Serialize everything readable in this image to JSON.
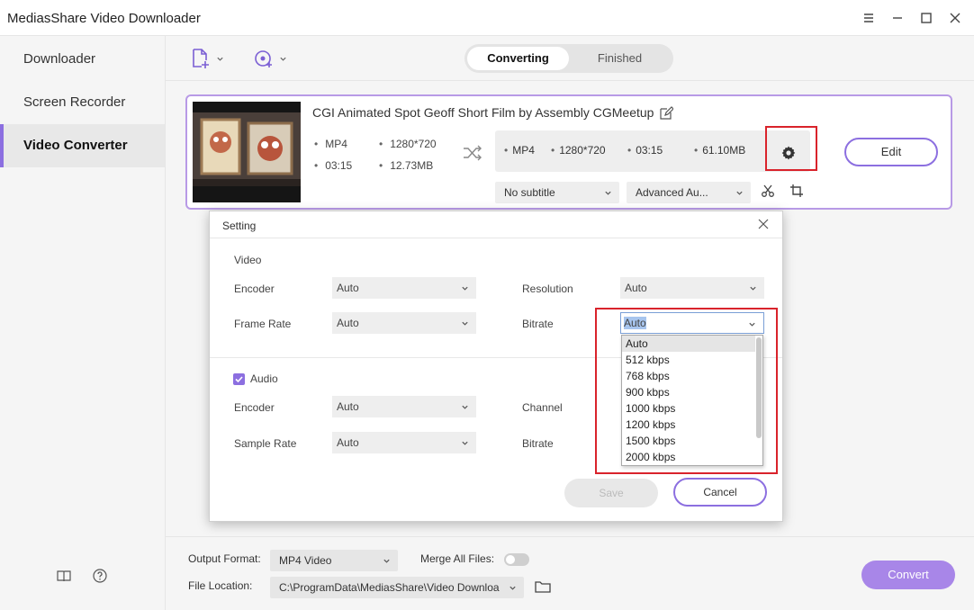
{
  "app": {
    "title": "MediasShare Video Downloader"
  },
  "sidebar": {
    "items": [
      {
        "label": "Downloader"
      },
      {
        "label": "Screen Recorder"
      },
      {
        "label": "Video Converter",
        "active": true
      }
    ]
  },
  "toolbar": {
    "tabs": [
      {
        "label": "Converting",
        "active": true
      },
      {
        "label": "Finished"
      }
    ]
  },
  "video": {
    "title": "CGI Animated Spot Geoff Short Film by Assembly  CGMeetup",
    "source": {
      "format": "MP4",
      "resolution": "1280*720",
      "duration": "03:15",
      "size": "12.73MB"
    },
    "target": {
      "format": "MP4",
      "resolution": "1280*720",
      "duration": "03:15",
      "size": "61.10MB"
    },
    "subtitle": "No subtitle",
    "audio_track": "Advanced Au...",
    "edit_label": "Edit"
  },
  "bottom": {
    "output_format_label": "Output Format:",
    "output_format": "MP4 Video",
    "merge_label": "Merge All Files:",
    "merge_enabled": false,
    "file_location_label": "File Location:",
    "file_location": "C:\\ProgramData\\MediasShare\\Video Downloa",
    "convert_label": "Convert"
  },
  "dialog": {
    "title": "Setting",
    "video_section": "Video",
    "encoder_label": "Encoder",
    "encoder_value": "Auto",
    "resolution_label": "Resolution",
    "resolution_value": "Auto",
    "framerate_label": "Frame Rate",
    "framerate_value": "Auto",
    "bitrate_label": "Bitrate",
    "bitrate_value": "Auto",
    "bitrate_options": [
      "Auto",
      "512 kbps",
      "768 kbps",
      "900 kbps",
      "1000 kbps",
      "1200 kbps",
      "1500 kbps",
      "2000 kbps"
    ],
    "audio_section": "Audio",
    "audio_enabled": true,
    "audio_encoder_label": "Encoder",
    "audio_encoder_value": "Auto",
    "channel_label": "Channel",
    "samplerate_label": "Sample Rate",
    "samplerate_value": "Auto",
    "audio_bitrate_label": "Bitrate",
    "save_label": "Save",
    "cancel_label": "Cancel"
  },
  "colors": {
    "accent": "#8c6fe0",
    "highlight": "#d9232b",
    "convert": "#a886e8"
  },
  "icons": [
    "add-file-icon",
    "download-add-icon",
    "chevron-down-icon",
    "pencil-icon",
    "shuffle-icon",
    "gear-icon",
    "scissors-icon",
    "crop-icon",
    "book-icon",
    "help-icon",
    "folder-icon",
    "close-icon",
    "menu-icon",
    "minimize-icon",
    "maximize-icon"
  ]
}
